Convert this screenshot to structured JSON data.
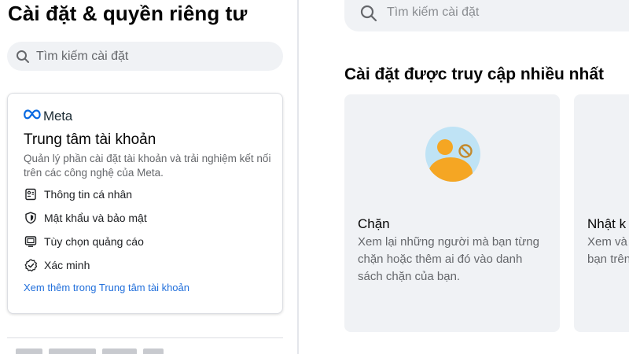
{
  "left_panel": {
    "title": "Cài đặt & quyền riêng tư",
    "search": {
      "placeholder": "Tìm kiếm cài đặt",
      "icon": "search-icon"
    },
    "accounts_center": {
      "brand": "Meta",
      "title": "Trung tâm tài khoản",
      "description": "Quản lý phần cài đặt tài khoản và trải nghiệm kết nối trên các công nghệ của Meta.",
      "items": [
        {
          "label": "Thông tin cá nhân",
          "icon": "id-card-icon"
        },
        {
          "label": "Mật khẩu và bảo mật",
          "icon": "shield-icon"
        },
        {
          "label": "Tùy chọn quảng cáo",
          "icon": "monitor-icon"
        },
        {
          "label": "Xác minh",
          "icon": "verified-badge-icon"
        }
      ],
      "link": "Xem thêm trong Trung tâm tài khoản"
    }
  },
  "right_panel": {
    "search": {
      "placeholder": "Tìm kiếm cài đặt",
      "icon": "search-icon"
    },
    "section_title": "Cài đặt được truy cập nhiều nhất",
    "tiles": [
      {
        "title": "Chặn",
        "description": "Xem lại những người mà bạn từng chặn hoặc thêm ai đó vào danh sách chặn của bạn.",
        "icon": "blocked-user-icon"
      },
      {
        "title": "Nhật k",
        "description_lines": [
          "Xem và",
          "bạn trên"
        ]
      }
    ]
  },
  "colors": {
    "accent_link": "#216fdb",
    "search_bg": "#f0f2f5",
    "tile_bg": "#f0f2f5",
    "illus_bg": "#bfe3f5",
    "illus_person": "#f5a623"
  }
}
